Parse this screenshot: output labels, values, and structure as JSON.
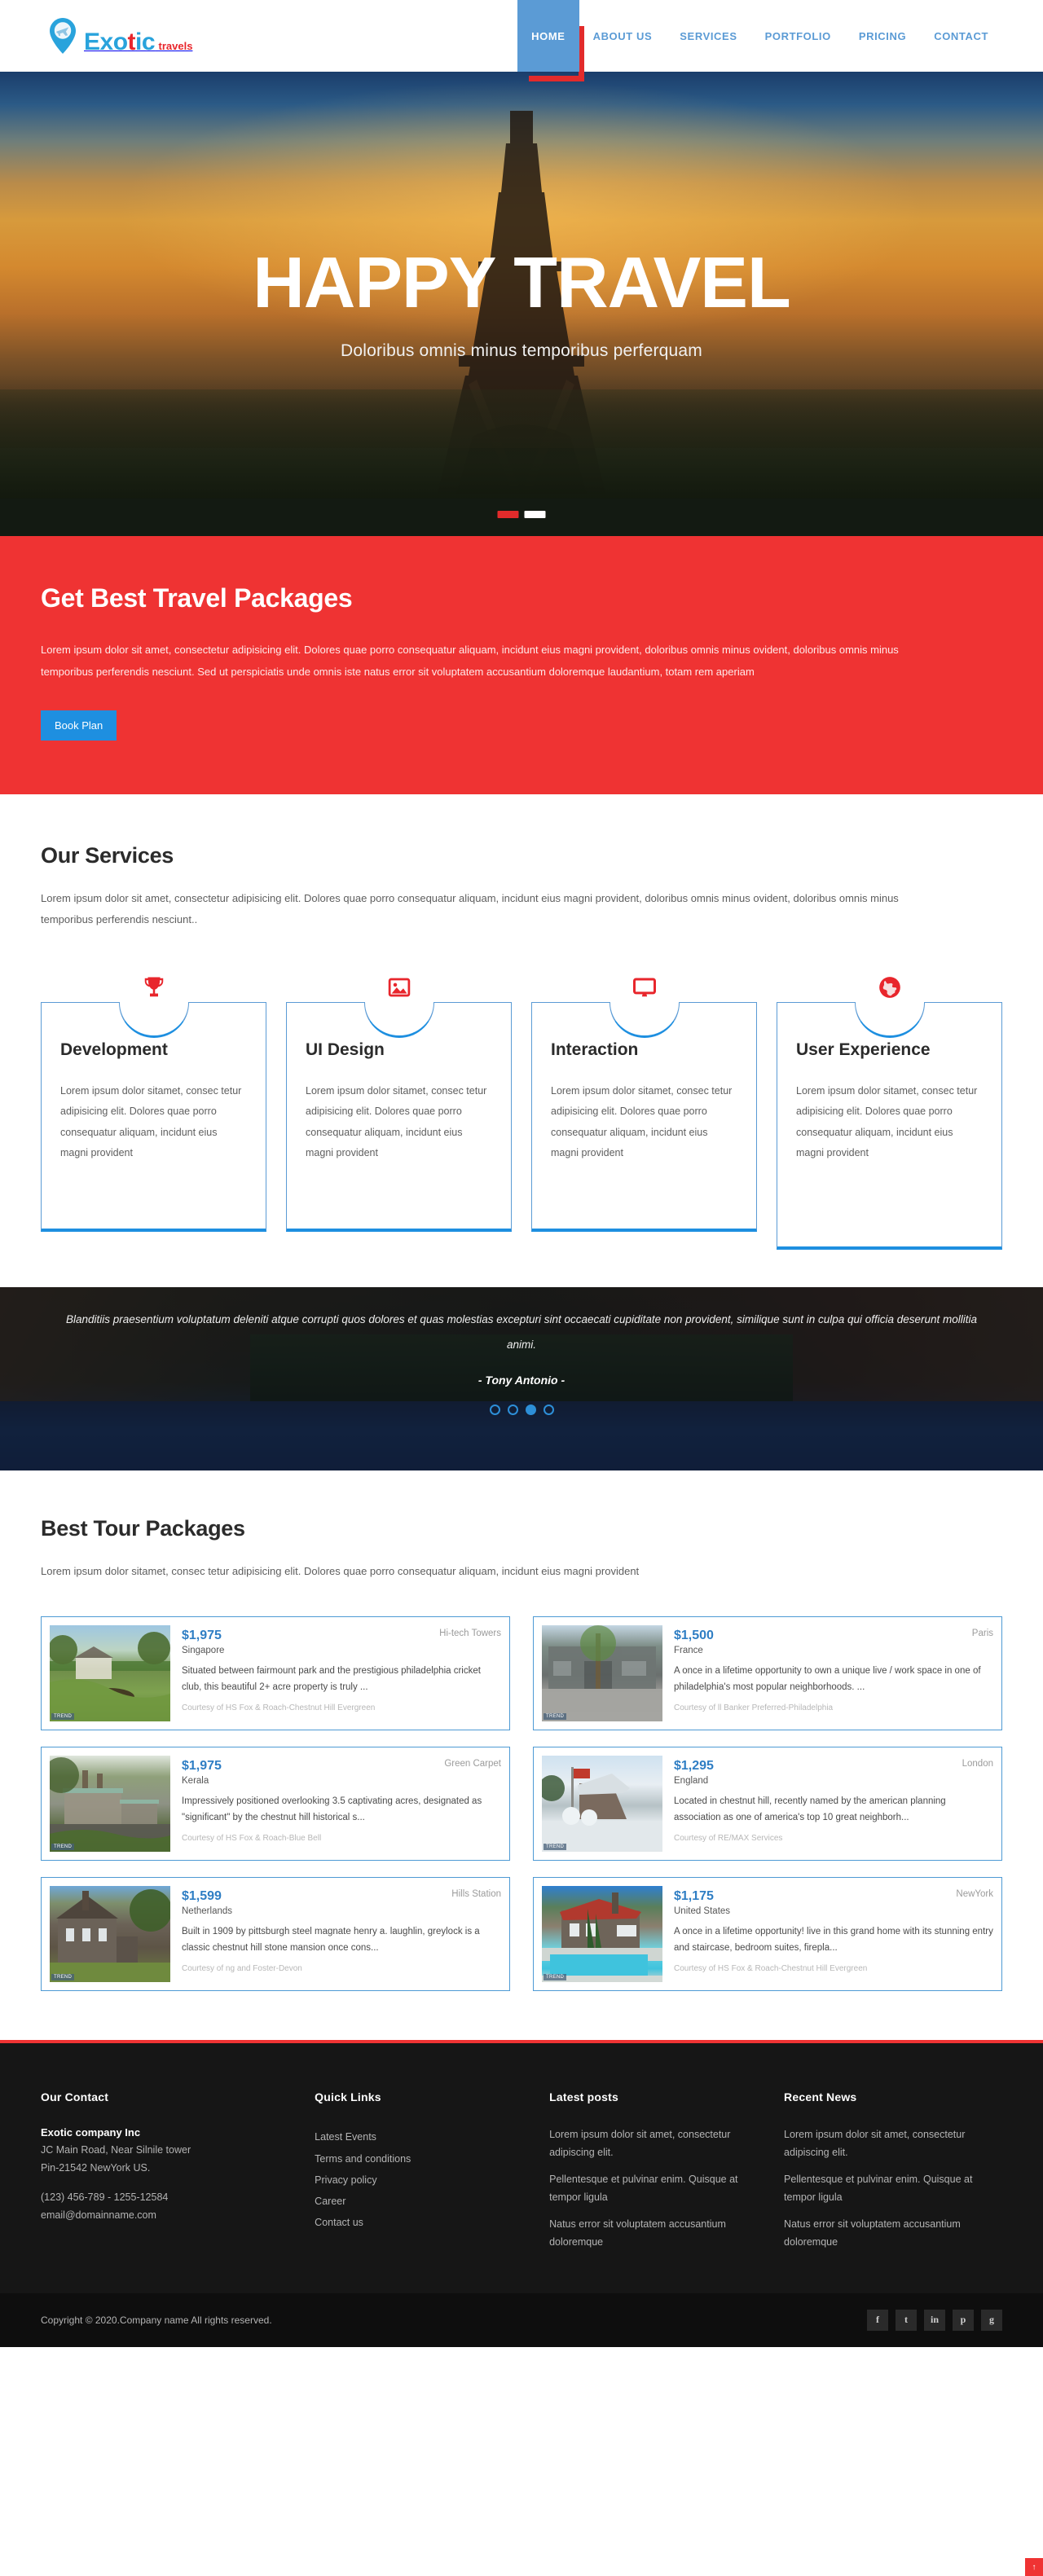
{
  "brand": {
    "name_part1": "Exo",
    "name_part_red": "t",
    "name_part3": "ic",
    "word": "Exotic",
    "tagline": "travels",
    "pin_icon": "map-pin-airplane-icon"
  },
  "nav": {
    "items": [
      {
        "label": "HOME",
        "active": true
      },
      {
        "label": "ABOUT US",
        "active": false
      },
      {
        "label": "SERVICES",
        "active": false
      },
      {
        "label": "PORTFOLIO",
        "active": false
      },
      {
        "label": "PRICING",
        "active": false
      },
      {
        "label": "CONTACT",
        "active": false
      }
    ]
  },
  "hero": {
    "title": "HAPPY TRAVEL",
    "subtitle": "Doloribus omnis minus temporibus perferquam",
    "slides": [
      {
        "active": false
      },
      {
        "active": true
      }
    ]
  },
  "promo": {
    "title": "Get Best Travel Packages",
    "paragraph": "Lorem ipsum dolor sit amet, consectetur adipisicing elit. Dolores quae porro consequatur aliquam, incidunt eius magni provident, doloribus omnis minus ovident, doloribus omnis minus temporibus perferendis nesciunt. Sed ut perspiciatis unde omnis iste natus error sit voluptatem accusantium doloremque laudantium, totam rem aperiam",
    "button_label": "Book Plan",
    "bg_color": "#ef3333",
    "button_color": "#1e8fe0"
  },
  "services": {
    "title": "Our Services",
    "description": "Lorem ipsum dolor sit amet, consectetur adipisicing elit. Dolores quae porro consequatur aliquam, incidunt eius magni provident, doloribus omnis minus ovident, doloribus omnis minus temporibus perferendis nesciunt..",
    "cards": [
      {
        "icon": "trophy-icon",
        "title": "Development",
        "text": "Lorem ipsum dolor sitamet, consec tetur adipisicing elit. Dolores quae porro consequatur aliquam, incidunt eius magni provident"
      },
      {
        "icon": "image-icon",
        "title": "UI Design",
        "text": "Lorem ipsum dolor sitamet, consec tetur adipisicing elit. Dolores quae porro consequatur aliquam, incidunt eius magni provident"
      },
      {
        "icon": "desktop-monitor-icon",
        "title": "Interaction",
        "text": "Lorem ipsum dolor sitamet, consec tetur adipisicing elit. Dolores quae porro consequatur aliquam, incidunt eius magni provident"
      },
      {
        "icon": "globe-icon",
        "title": "User Experience",
        "text": "Lorem ipsum dolor sitamet, consec tetur adipisicing elit. Dolores quae porro consequatur aliquam, incidunt eius magni provident"
      }
    ]
  },
  "testimonial": {
    "quote": "Blanditiis praesentium voluptatum deleniti atque corrupti quos dolores et quas molestias excepturi sint occaecati cupiditate non provident, similique sunt in culpa qui officia deserunt mollitia animi.",
    "author": "- Tony Antonio -",
    "dots": [
      {
        "active": false
      },
      {
        "active": false
      },
      {
        "active": true
      },
      {
        "active": false
      }
    ]
  },
  "packages": {
    "title": "Best Tour Packages",
    "description": "Lorem ipsum dolor sitamet, consec tetur adipisicing elit. Dolores quae porro consequatur aliquam, incidunt eius magni provident",
    "items": [
      {
        "price": "$1,975",
        "place": "Hi-tech Towers",
        "country": "Singapore",
        "description": "Situated between fairmount park and the prestigious philadelphia cricket club, this beautiful 2+ acre property is truly ...",
        "courtesy": "Courtesy of HS Fox & Roach-Chestnut Hill Evergreen",
        "thumb_class": "t-green",
        "thumb_badge": "TREND"
      },
      {
        "price": "$1,500",
        "place": "Paris",
        "country": "France",
        "description": "A once in a lifetime opportunity to own a unique live / work space in one of philadelphia's most popular neighborhoods. ...",
        "courtesy": "Courtesy of ll Banker Preferred-Philadelphia",
        "thumb_class": "t-gray",
        "thumb_badge": "TREND"
      },
      {
        "price": "$1,975",
        "place": "Green Carpet",
        "country": "Kerala",
        "description": "Impressively positioned overlooking 3.5 captivating acres, designated as \"significant\" by the chestnut hill historical s...",
        "courtesy": "Courtesy of HS Fox & Roach-Blue Bell",
        "thumb_class": "t-stone",
        "thumb_badge": "TREND"
      },
      {
        "price": "$1,295",
        "place": "London",
        "country": "England",
        "description": "Located in chestnut hill, recently named by the american planning association as one of america's top 10 great neighborh...",
        "courtesy": "Courtesy of RE/MAX Services",
        "thumb_class": "t-snow",
        "thumb_badge": "TREND"
      },
      {
        "price": "$1,599",
        "place": "Hills Station",
        "country": "Netherlands",
        "description": "Built in 1909 by pittsburgh steel magnate henry a. laughlin, greylock is a classic chestnut hill stone mansion once cons...",
        "courtesy": "Courtesy of ng and Foster-Devon",
        "thumb_class": "t-dark",
        "thumb_badge": "TREND"
      },
      {
        "price": "$1,175",
        "place": "NewYork",
        "country": "United States",
        "description": "A once in a lifetime opportunity! live in this grand home with its stunning entry and staircase, bedroom suites, firepla...",
        "courtesy": "Courtesy of HS Fox & Roach-Chestnut Hill Evergreen",
        "thumb_class": "t-pool",
        "thumb_badge": "TREND"
      }
    ]
  },
  "footer": {
    "contact": {
      "heading": "Our Contact",
      "company": "Exotic company Inc",
      "address_line1": "JC Main Road, Near Silnile tower",
      "address_line2": "Pin-21542 NewYork US.",
      "phone": "(123) 456-789 - 1255-12584",
      "email": "email@domainname.com"
    },
    "quick_links": {
      "heading": "Quick Links",
      "links": [
        "Latest Events",
        "Terms and conditions",
        "Privacy policy",
        "Career",
        "Contact us"
      ]
    },
    "latest_posts": {
      "heading": "Latest posts",
      "posts": [
        "Lorem ipsum dolor sit amet, consectetur adipiscing elit.",
        "Pellentesque et pulvinar enim. Quisque at tempor ligula",
        "Natus error sit voluptatem accusantium doloremque"
      ]
    },
    "recent_news": {
      "heading": "Recent News",
      "posts": [
        "Lorem ipsum dolor sit amet, consectetur adipiscing elit.",
        "Pellentesque et pulvinar enim. Quisque at tempor ligula",
        "Natus error sit voluptatem accusantium doloremque"
      ]
    },
    "copyright": "Copyright © 2020.Company name All rights reserved.",
    "socials": [
      {
        "icon": "facebook-icon",
        "glyph": "f"
      },
      {
        "icon": "twitter-icon",
        "glyph": "t"
      },
      {
        "icon": "linkedin-icon",
        "glyph": "in"
      },
      {
        "icon": "pinterest-icon",
        "glyph": "p"
      },
      {
        "icon": "google-plus-icon",
        "glyph": "g"
      }
    ],
    "scroll_top_label": "↑"
  }
}
